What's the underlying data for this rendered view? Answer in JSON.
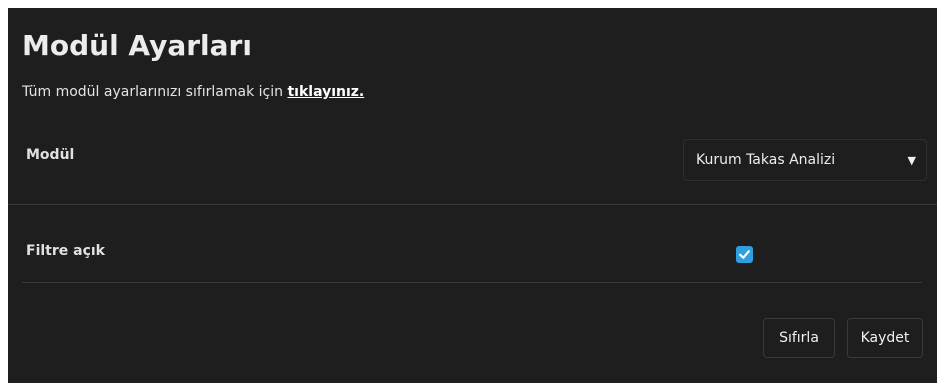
{
  "settings": {
    "title": "Modül Ayarları",
    "reset_note_text": "Tüm modül ayarlarınızı sıfırlamak için ",
    "reset_link": "tıklayınız.",
    "module_row": {
      "label": "Modül",
      "selected_value": "Kurum Takas Analizi"
    },
    "filter_row": {
      "label": "Filtre açık",
      "checked": true
    },
    "buttons": {
      "reset": "Sıfırla",
      "save": "Kaydet"
    }
  },
  "colors": {
    "panel_background": "#1e1e1e",
    "checkbox_accent": "#2f9fe0"
  }
}
